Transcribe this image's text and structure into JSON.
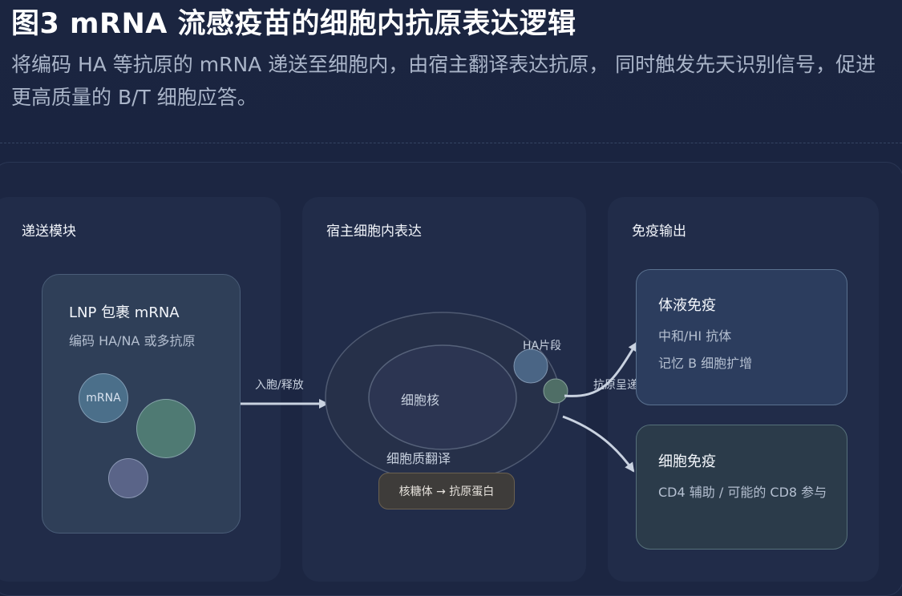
{
  "header": {
    "title": "图3 mRNA 流感疫苗的细胞内抗原表达逻辑",
    "subtitle": "将编码 HA 等抗原的 mRNA 递送至细胞内，由宿主翻译表达抗原， 同时触发先天识别信号，促进更高质量的 B/T 细胞应答。"
  },
  "columns": {
    "delivery": {
      "title": "递送模块"
    },
    "host": {
      "title": "宿主细胞内表达"
    },
    "immune": {
      "title": "免疫输出"
    }
  },
  "lnp_card": {
    "title": "LNP 包裹 mRNA",
    "subtitle": "编码 HA/NA 或多抗原",
    "bubble_label": "mRNA"
  },
  "arrows": {
    "entry_label": "入胞/释放",
    "presentation_label": "抗原呈递"
  },
  "cell": {
    "nucleus_label": "细胞核",
    "cytoplasm_label": "细胞质翻译",
    "ribosome_label": "核糖体 → 抗原蛋白",
    "fragment_label": "HA片段"
  },
  "outputs": {
    "humoral": {
      "title": "体液免疫",
      "lines": [
        "中和/HI 抗体",
        "记忆 B 细胞扩增"
      ]
    },
    "cellular": {
      "title": "细胞免疫",
      "lines": [
        "CD4 辅助 / 可能的 CD8 参与"
      ]
    }
  },
  "colors": {
    "bubble_mrna": "#4b6f8a",
    "bubble_green": "#4f7a73",
    "bubble_purple": "#5a6488",
    "fragment_blue": "#4a6585",
    "fragment_green": "#4f6e66",
    "arrow": "#c9d2e0"
  }
}
